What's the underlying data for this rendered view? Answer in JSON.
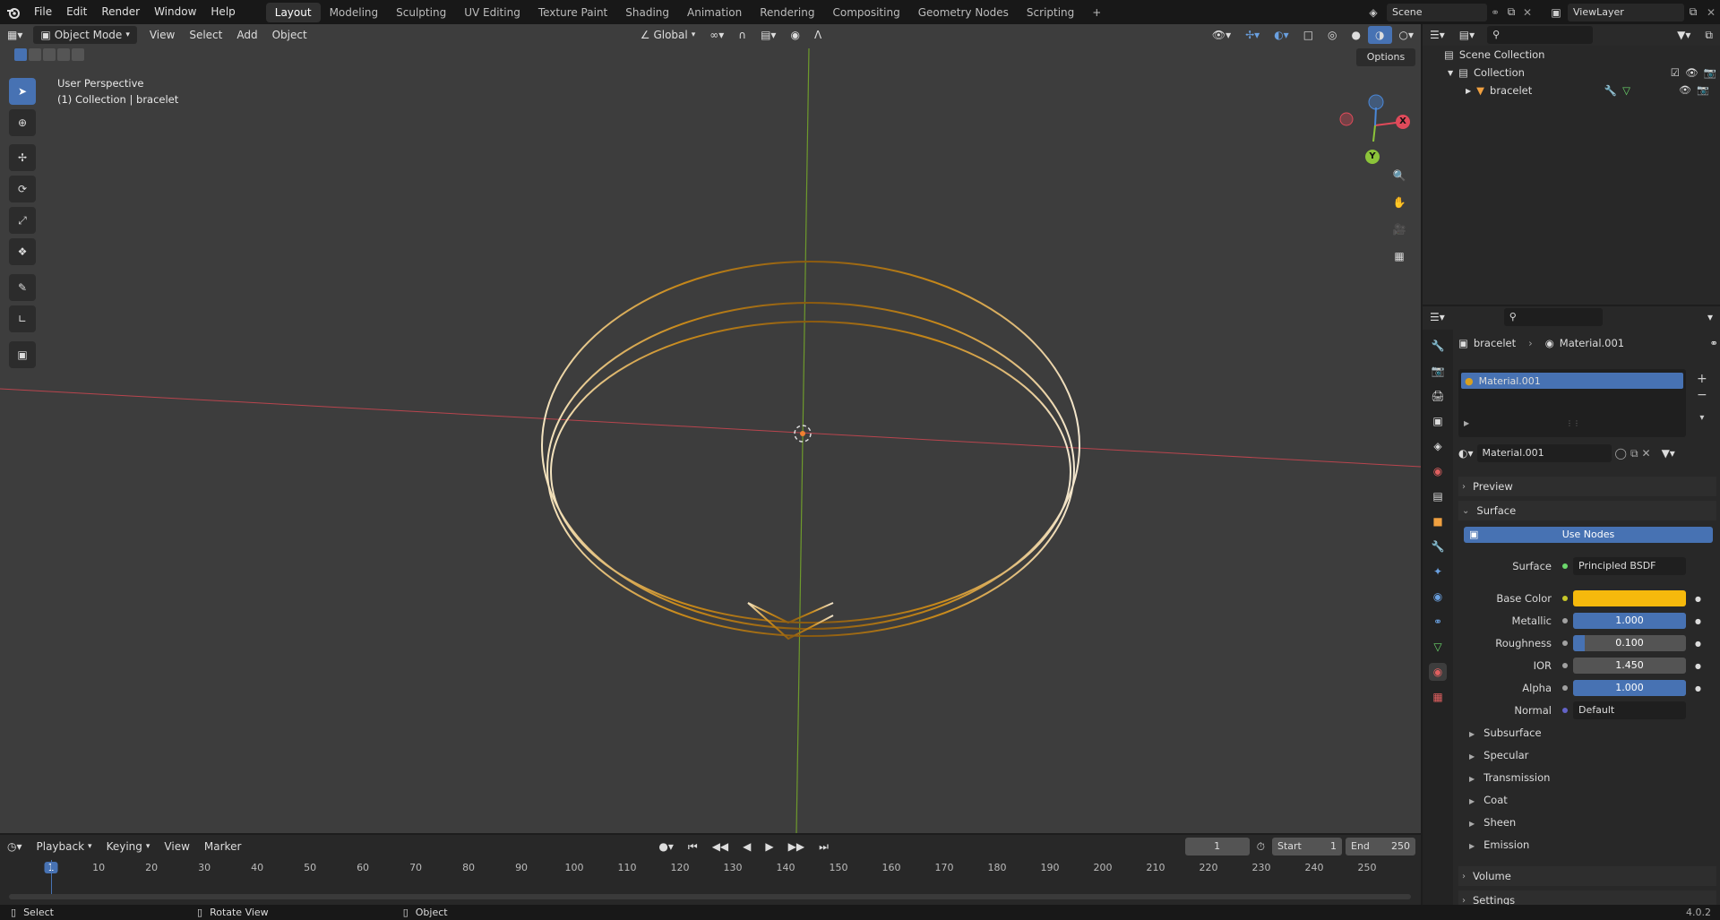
{
  "menu": {
    "items": [
      "File",
      "Edit",
      "Render",
      "Window",
      "Help"
    ],
    "workspaces": [
      "Layout",
      "Modeling",
      "Sculpting",
      "UV Editing",
      "Texture Paint",
      "Shading",
      "Animation",
      "Rendering",
      "Compositing",
      "Geometry Nodes",
      "Scripting"
    ],
    "add_tab": "+",
    "scene": "Scene",
    "view_layer": "ViewLayer"
  },
  "viewport": {
    "mode": "Object Mode",
    "menus": [
      "View",
      "Select",
      "Add",
      "Object"
    ],
    "orientation": "Global",
    "options": "Options",
    "overlay_title": "User Perspective",
    "overlay_sub": "(1) Collection | bracelet",
    "gizmo": {
      "x": "X",
      "y": "Y"
    }
  },
  "outliner": {
    "root": "Scene Collection",
    "collection": "Collection",
    "object": "bracelet"
  },
  "properties": {
    "breadcrumb_object": "bracelet",
    "breadcrumb_material": "Material.001",
    "slot": "Material.001",
    "material_name": "Material.001",
    "panel_preview": "Preview",
    "panel_surface": "Surface",
    "use_nodes": "Use Nodes",
    "surface_label": "Surface",
    "surface_value": "Principled BSDF",
    "base_color_label": "Base Color",
    "base_color": "#f6b90c",
    "metallic_label": "Metallic",
    "metallic": "1.000",
    "metallic_fraction": 1.0,
    "roughness_label": "Roughness",
    "roughness": "0.100",
    "roughness_fraction": 0.1,
    "ior_label": "IOR",
    "ior": "1.450",
    "ior_fraction": 0.0,
    "alpha_label": "Alpha",
    "alpha": "1.000",
    "alpha_fraction": 1.0,
    "normal_label": "Normal",
    "normal": "Default",
    "subpanels": [
      "Subsurface",
      "Specular",
      "Transmission",
      "Coat",
      "Sheen",
      "Emission"
    ],
    "panel_volume": "Volume",
    "panel_settings": "Settings"
  },
  "timeline": {
    "menus": [
      "Playback",
      "Keying",
      "View",
      "Marker"
    ],
    "current_frame": "1",
    "start_label": "Start",
    "start": "1",
    "end_label": "End",
    "end": "250",
    "ticks": [
      "1",
      "10",
      "20",
      "30",
      "40",
      "50",
      "60",
      "70",
      "80",
      "90",
      "100",
      "110",
      "120",
      "130",
      "140",
      "150",
      "160",
      "170",
      "180",
      "190",
      "200",
      "210",
      "220",
      "230",
      "240",
      "250"
    ]
  },
  "status": {
    "select": "Select",
    "rotate": "Rotate View",
    "object": "Object",
    "version": "4.0.2"
  },
  "colors": {
    "accent": "#4772b3",
    "x_axis": "#e04a5a",
    "y_axis": "#8cc43a",
    "z_axis": "#4a88d8"
  }
}
